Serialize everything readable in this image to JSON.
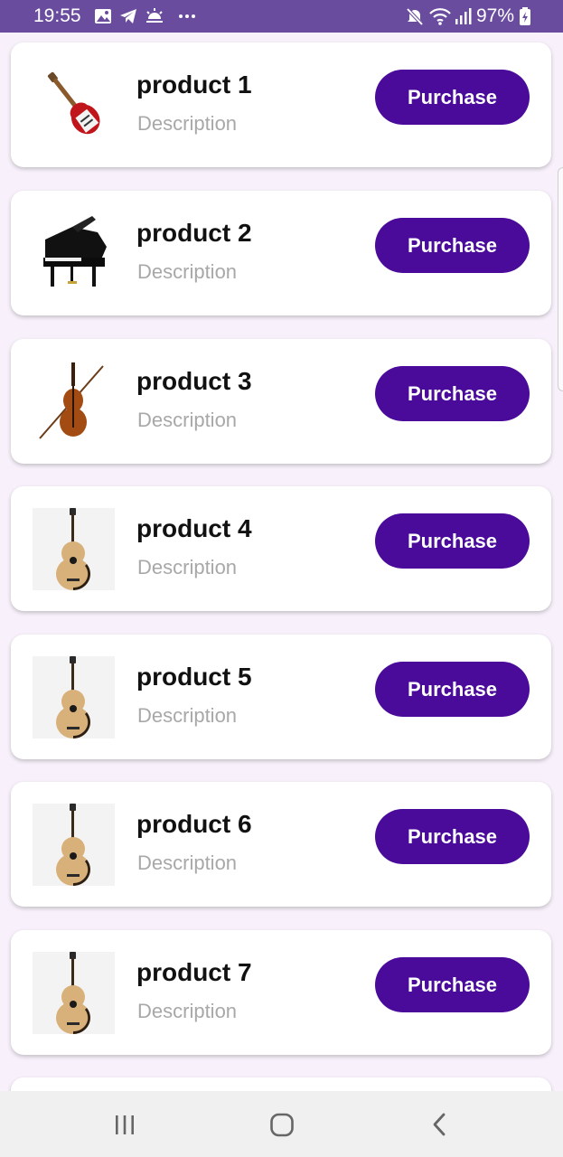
{
  "status_bar": {
    "time": "19:55",
    "battery": "97%",
    "icons": [
      "gallery-icon",
      "telegram-icon",
      "weather-icon",
      "more-dots-icon",
      "mute-icon",
      "wifi-icon",
      "signal-icon",
      "battery-charging-icon"
    ]
  },
  "products": [
    {
      "name": "product 1",
      "description": "Description",
      "button": "Purchase",
      "image": "electric-guitar"
    },
    {
      "name": "product 2",
      "description": "Description",
      "button": "Purchase",
      "image": "grand-piano"
    },
    {
      "name": "product 3",
      "description": "Description",
      "button": "Purchase",
      "image": "violin"
    },
    {
      "name": "product 4",
      "description": "Description",
      "button": "Purchase",
      "image": "acoustic-guitar"
    },
    {
      "name": "product 5",
      "description": "Description",
      "button": "Purchase",
      "image": "acoustic-guitar"
    },
    {
      "name": "product 6",
      "description": "Description",
      "button": "Purchase",
      "image": "acoustic-guitar"
    },
    {
      "name": "product 7",
      "description": "Description",
      "button": "Purchase",
      "image": "acoustic-guitar"
    }
  ],
  "nav_bar": {
    "icons": [
      "recent-apps-icon",
      "home-icon",
      "back-icon"
    ]
  },
  "colors": {
    "status_bar": "#6a4c9e",
    "button": "#4a0a9a",
    "background": "#f8f1fb"
  }
}
